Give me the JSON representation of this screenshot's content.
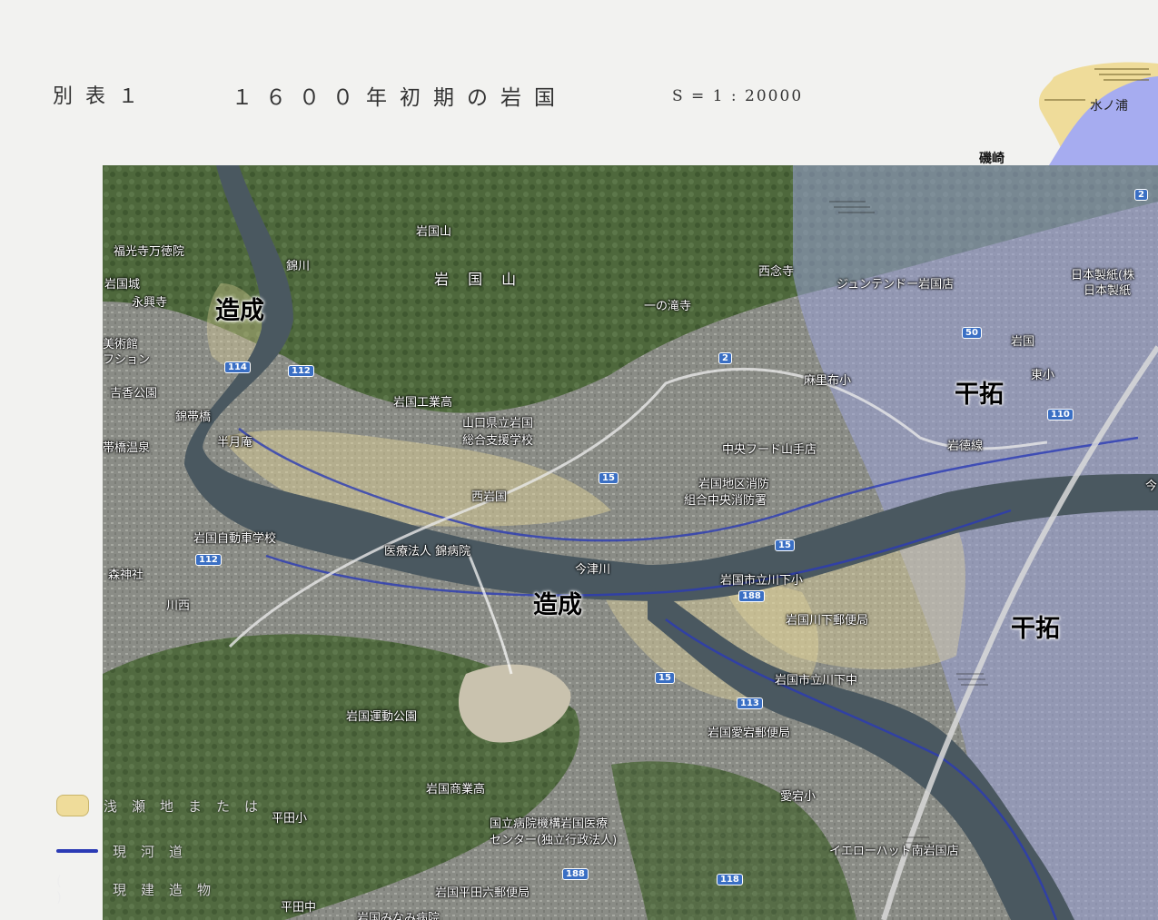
{
  "header": {
    "table_label": "別表１",
    "title": "１６００年初期の岩国",
    "scale": "S = 1 : 20000"
  },
  "inset": {
    "place_sea": "水ノ浦",
    "place_land": "磯崎"
  },
  "overlay_labels": {
    "zosei_1": "造成",
    "zosei_2": "造成",
    "kantaku_1": "干拓",
    "kantaku_2": "干拓"
  },
  "places": [
    "福光寺万徳院",
    "岩国城",
    "永興寺",
    "美術館",
    "フション",
    "吉香公園",
    "錦帯橋",
    "帯橋温泉",
    "半月庵",
    "岩国山",
    "岩 国 山",
    "一の滝寺",
    "西念寺",
    "ジュンテンドー岩国店",
    "日本製紙(株",
    "日本製紙",
    "岩国",
    "東小",
    "麻里布小",
    "岩国工業高",
    "山口県立岩国",
    "総合支援学校",
    "岩徳線",
    "中央フード山手店",
    "岩国地区消防",
    "組合中央消防署",
    "西岩国",
    "岩国自動車学校",
    "医療法人 錦病院",
    "森神社",
    "川西",
    "岩国市立川下小",
    "岩国川下郵便局",
    "岩国市立川下中",
    "岩国運動公園",
    "岩国愛宕郵便局",
    "岩国商業高",
    "愛宕小",
    "平田小",
    "国立病院機構岩国医療",
    "センター(独立行政法人)",
    "イエローハット南岩国店",
    "岩国平田六郵便局",
    "平田中",
    "岩国みなみ病院",
    "今津川",
    "今",
    "錦川"
  ],
  "roads": [
    "114",
    "112",
    "2",
    "50",
    "110",
    "15",
    "112",
    "15",
    "188",
    "15",
    "113",
    "188",
    "118",
    "2"
  ],
  "legend": [
    {
      "swatch": "yellow",
      "text": "浅瀬地または"
    },
    {
      "swatch": "blue",
      "text": "現河道"
    },
    {
      "swatch": "paren",
      "mark": "( )",
      "text": "現建造物"
    }
  ],
  "colors": {
    "mountain": "#4f6a3e",
    "urban": "#8d8f88",
    "river": "#4b5a63",
    "reclaimed_tint": "#9aa2d8",
    "landfill_tint": "#e6d79a",
    "legend_blue": "#2b3bb5",
    "sea": "#a6acf0"
  }
}
